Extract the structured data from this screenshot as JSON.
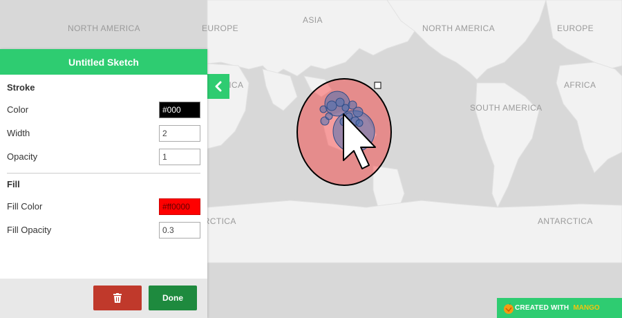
{
  "map": {
    "labels": [
      "NORTH AMERICA",
      "EUROPE",
      "ASIA",
      "NORTH AMERICA",
      "EUROPE",
      "AFRICA",
      "AFRICA",
      "SOUTH AMERICA",
      "ANTARCTICA",
      "ANTARCTICA"
    ],
    "land_color": "#f2f2f2",
    "ocean_color": "#d8d8d8",
    "shape_fill": "#ff0000",
    "shape_stroke": "#000000",
    "marker_color": "#4a6fb0"
  },
  "panel": {
    "title": "Untitled Sketch",
    "stroke_section": "Stroke",
    "stroke_color_label": "Color",
    "stroke_color_value": "#000",
    "width_label": "Width",
    "width_value": "2",
    "opacity_label": "Opacity",
    "opacity_value": "1",
    "fill_section": "Fill",
    "fill_color_label": "Fill Color",
    "fill_color_value": "#ff0000",
    "fill_opacity_label": "Fill Opacity",
    "fill_opacity_value": "0.3",
    "done_label": "Done",
    "accent_color": "#2ecc71"
  },
  "badge": {
    "text": "CREATED WITH",
    "brand": "MANGO"
  }
}
